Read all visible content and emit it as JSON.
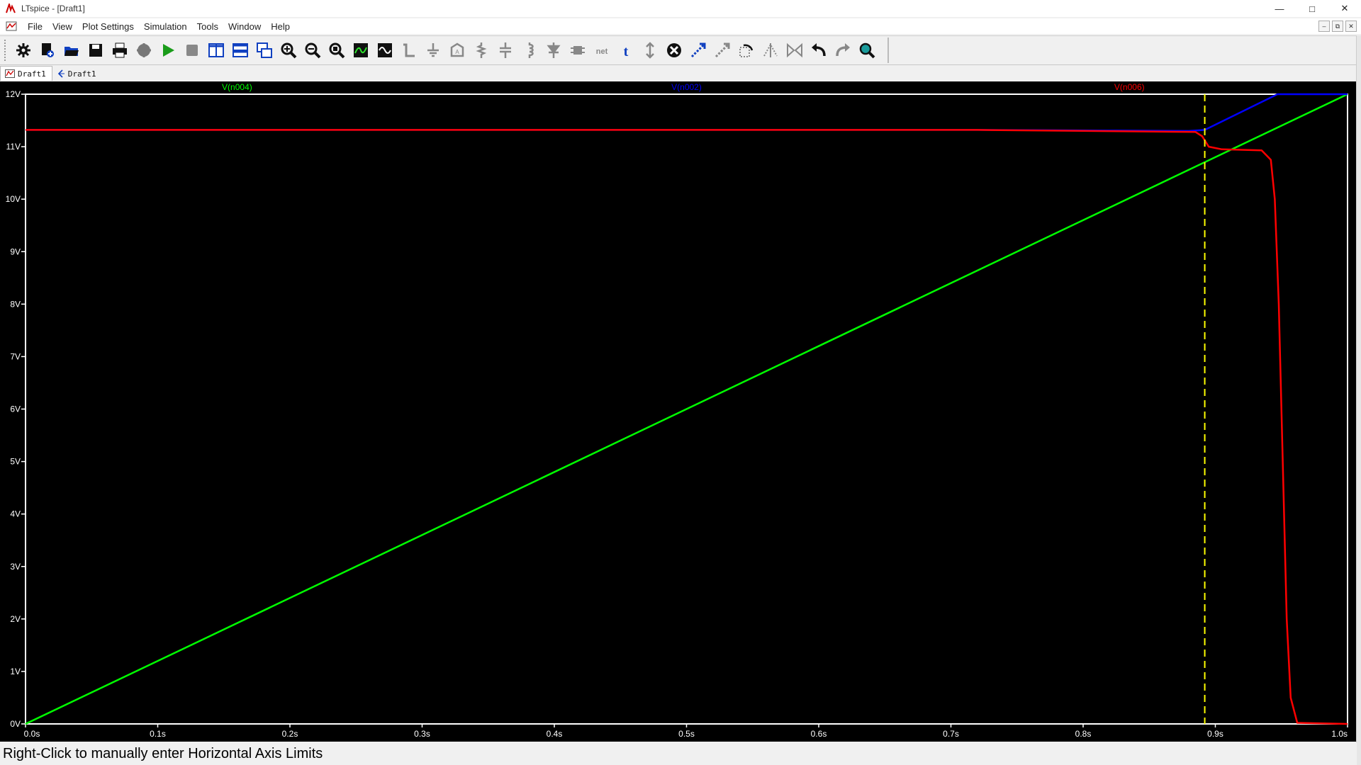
{
  "window": {
    "title": "LTspice - [Draft1]"
  },
  "menu": {
    "items": [
      "File",
      "View",
      "Plot Settings",
      "Simulation",
      "Tools",
      "Window",
      "Help"
    ]
  },
  "tabs": [
    {
      "label": "Draft1"
    },
    {
      "label": "Draft1"
    }
  ],
  "toolbar": {
    "icons": [
      "gear-icon",
      "new-schematic-icon",
      "open-icon",
      "save-icon",
      "print-icon",
      "halt-icon",
      "run-icon",
      "stop-icon",
      "tile-vertical-icon",
      "tile-horizontal-icon",
      "cascade-icon",
      "zoom-in-icon",
      "zoom-out-icon",
      "zoom-fit-icon",
      "autorange-icon",
      "waveform-icon",
      "wire-icon",
      "ground-icon",
      "net-label-icon",
      "resistor-icon",
      "capacitor-icon",
      "inductor-icon",
      "diode-icon",
      "component-icon",
      "net-name-icon",
      "text-icon",
      "spice-directive-icon",
      "delete-icon",
      "move-icon",
      "drag-icon",
      "rotate-icon",
      "mirror-icon",
      "flip-icon",
      "undo-icon",
      "redo-icon",
      "find-icon"
    ]
  },
  "statusbar": {
    "text": "Right-Click to manually enter Horizontal Axis Limits"
  },
  "colors": {
    "background": "#000000",
    "axis": "#ffffff",
    "v_n004": "#00ff00",
    "v_n002": "#0000ff",
    "v_n006": "#ff0000",
    "cursor": "#ffff00"
  },
  "chart_data": {
    "type": "line",
    "xlim": [
      0,
      1.0
    ],
    "ylim": [
      0,
      12
    ],
    "x_ticks": [
      "0.0s",
      "0.1s",
      "0.2s",
      "0.3s",
      "0.4s",
      "0.5s",
      "0.6s",
      "0.7s",
      "0.8s",
      "0.9s",
      "1.0s"
    ],
    "y_ticks": [
      "0V",
      "1V",
      "2V",
      "3V",
      "4V",
      "5V",
      "6V",
      "7V",
      "8V",
      "9V",
      "10V",
      "11V",
      "12V"
    ],
    "grid": false,
    "cursor_x": 0.892,
    "series": [
      {
        "name": "V(n004)",
        "color": "#00ff00",
        "points": [
          [
            0,
            0
          ],
          [
            1.0,
            12
          ]
        ]
      },
      {
        "name": "V(n002)",
        "color": "#0000ff",
        "points": [
          [
            0,
            11.32
          ],
          [
            0.72,
            11.32
          ],
          [
            0.88,
            11.3
          ],
          [
            0.892,
            11.32
          ],
          [
            0.947,
            12
          ],
          [
            1.0,
            12
          ]
        ]
      },
      {
        "name": "V(n006)",
        "color": "#ff0000",
        "points": [
          [
            0,
            11.32
          ],
          [
            0.72,
            11.32
          ],
          [
            0.885,
            11.28
          ],
          [
            0.89,
            11.2
          ],
          [
            0.895,
            11.0
          ],
          [
            0.905,
            10.95
          ],
          [
            0.935,
            10.93
          ],
          [
            0.942,
            10.75
          ],
          [
            0.945,
            10.0
          ],
          [
            0.948,
            8.0
          ],
          [
            0.951,
            5.0
          ],
          [
            0.954,
            2.0
          ],
          [
            0.957,
            0.5
          ],
          [
            0.962,
            0.02
          ],
          [
            1.0,
            0.0
          ]
        ]
      }
    ]
  }
}
